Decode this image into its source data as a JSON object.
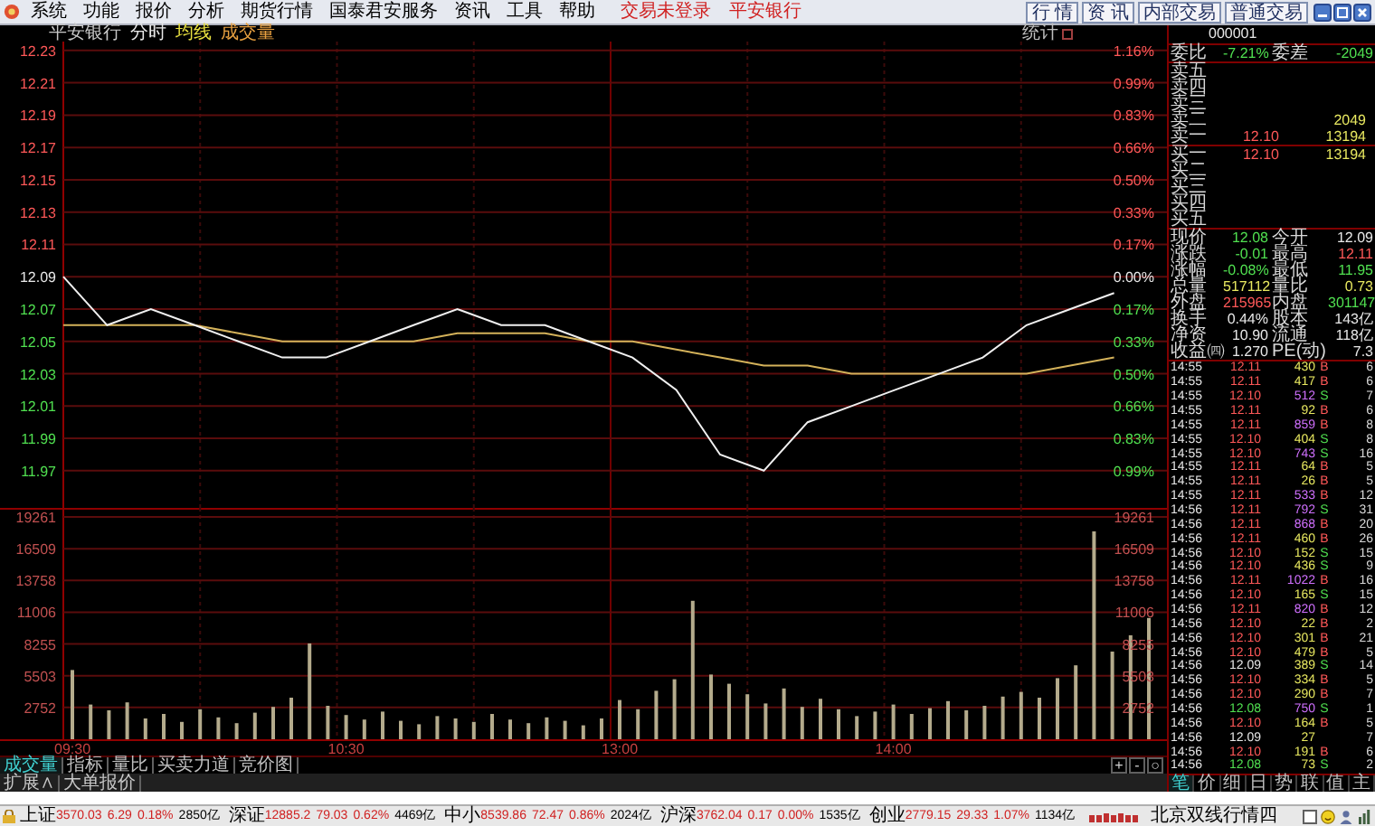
{
  "menu": [
    "系统",
    "功能",
    "报价",
    "分析",
    "期货行情",
    "国泰君安服务",
    "资讯",
    "工具",
    "帮助"
  ],
  "trade_status": [
    "交易未登录",
    "平安银行"
  ],
  "toolbar_buttons": [
    "行 情",
    "资 讯",
    "内部交易",
    "普通交易"
  ],
  "chart_header": {
    "stock": "平安银行",
    "items": [
      {
        "label": "分时",
        "color": "#e8e8e8"
      },
      {
        "label": "均线",
        "color": "#e8e040"
      },
      {
        "label": "成交量",
        "color": "#e8a040"
      }
    ],
    "stats_toggle": "统计"
  },
  "price_chart": {
    "chart_data": {
      "type": "line",
      "categories": [
        null,
        null,
        null,
        null,
        null,
        null,
        null,
        null,
        null,
        null,
        null,
        null,
        null,
        null,
        null,
        null,
        null,
        null,
        null,
        null,
        null,
        null,
        null,
        null,
        null
      ],
      "ylim": [
        11.947,
        12.2355
      ],
      "grid": true,
      "series": [
        {
          "color": "#f0f0f0",
          "values": [
            12.09,
            12.06,
            12.07,
            12.06,
            12.05,
            12.04,
            12.04,
            12.05,
            12.06,
            12.07,
            12.06,
            12.06,
            12.05,
            12.04,
            12.02,
            11.98,
            11.97,
            12.0,
            12.01,
            12.02,
            12.03,
            12.04,
            12.06,
            12.07,
            12.08
          ]
        },
        {
          "color": "#d4b25a",
          "values": [
            12.06,
            12.06,
            12.06,
            12.06,
            12.055,
            12.05,
            12.05,
            12.05,
            12.05,
            12.055,
            12.055,
            12.055,
            12.05,
            12.05,
            12.045,
            12.04,
            12.035,
            12.035,
            12.03,
            12.03,
            12.03,
            12.03,
            12.03,
            12.035,
            12.04
          ]
        }
      ],
      "yticks": [
        {
          "value": 12.23,
          "label": "12.23"
        },
        {
          "value": 12.21,
          "label": "12.21"
        },
        {
          "value": 12.19,
          "label": "12.19"
        },
        {
          "value": 12.17,
          "label": "12.17"
        },
        {
          "value": 12.15,
          "label": "12.15"
        },
        {
          "value": 12.13,
          "label": "12.13"
        },
        {
          "value": 12.11,
          "label": "12.11"
        },
        {
          "value": 12.09,
          "label": "12.09"
        },
        {
          "value": 12.07,
          "label": "12.07"
        },
        {
          "value": 12.05,
          "label": "12.05"
        },
        {
          "value": 12.03,
          "label": "12.03"
        },
        {
          "value": 12.01,
          "label": "12.01"
        },
        {
          "value": 11.99,
          "label": "11.99"
        },
        {
          "value": 11.97,
          "label": "11.97"
        }
      ]
    },
    "percent_labels": [
      {
        "text": "1.16%",
        "color": "#ff5858"
      },
      {
        "text": "0.99%",
        "color": "#ff5858"
      },
      {
        "text": "0.83%",
        "color": "#ff5858"
      },
      {
        "text": "0.66%",
        "color": "#ff5858"
      },
      {
        "text": "0.50%",
        "color": "#ff5858"
      },
      {
        "text": "0.33%",
        "color": "#ff5858"
      },
      {
        "text": "0.17%",
        "color": "#ff5858"
      },
      {
        "text": "0.00%",
        "color": "#e8e8e8"
      },
      {
        "text": "0.17%",
        "color": "#50e050"
      },
      {
        "text": "0.33%",
        "color": "#50e050"
      },
      {
        "text": "0.50%",
        "color": "#50e050"
      },
      {
        "text": "0.66%",
        "color": "#50e050"
      },
      {
        "text": "0.83%",
        "color": "#50e050"
      },
      {
        "text": "0.99%",
        "color": "#50e050"
      }
    ]
  },
  "volume_chart": {
    "chart_data": {
      "type": "bar",
      "categories": [
        "09:30",
        null,
        null,
        null,
        null,
        null,
        null,
        null,
        null,
        null,
        null,
        null,
        null,
        null,
        null,
        "10:30",
        null,
        null,
        null,
        null,
        null,
        null,
        null,
        null,
        null,
        null,
        null,
        null,
        null,
        null,
        "13:00",
        null,
        null,
        null,
        null,
        null,
        null,
        null,
        null,
        null,
        null,
        null,
        null,
        null,
        null,
        "14:00",
        null,
        null,
        null,
        null,
        null,
        null,
        null,
        null,
        null,
        null,
        null,
        null,
        null,
        null
      ],
      "ylim": [
        0,
        20043
      ],
      "grid": true,
      "series": [
        {
          "color": "#b4ab8c",
          "values": [
            6000,
            3000,
            2500,
            3200,
            1800,
            2200,
            1500,
            2600,
            1900,
            1400,
            2300,
            2800,
            3600,
            8300,
            2900,
            2100,
            1700,
            2400,
            1600,
            1300,
            2000,
            1800,
            1500,
            2200,
            1700,
            1400,
            1900,
            1600,
            1200,
            1800,
            3400,
            2600,
            4200,
            5200,
            12000,
            5600,
            4800,
            3900,
            3100,
            4400,
            2800,
            3500,
            2600,
            2000,
            2400,
            3000,
            2200,
            2700,
            3300,
            2500,
            2900,
            3700,
            4100,
            3600,
            5300,
            6400,
            18000,
            7600,
            9000,
            10500
          ]
        }
      ],
      "yticks": [
        {
          "value": 19261,
          "label": "19261"
        },
        {
          "value": 16509,
          "label": "16509"
        },
        {
          "value": 13758,
          "label": "13758"
        },
        {
          "value": 11006,
          "label": "11006"
        },
        {
          "value": 8255,
          "label": "8255"
        },
        {
          "value": 5503,
          "label": "5503"
        },
        {
          "value": 2752,
          "label": "2752"
        }
      ]
    },
    "right_labels": [
      "19261",
      "16509",
      "13758",
      "11006",
      "8255",
      "5503",
      "2752"
    ]
  },
  "chart_tabs": [
    {
      "label": "成交量",
      "selected": true
    },
    {
      "label": "指标",
      "selected": false
    },
    {
      "label": "量比",
      "selected": false
    },
    {
      "label": "买卖力道",
      "selected": false
    },
    {
      "label": "竞价图",
      "selected": false
    }
  ],
  "zoom_buttons": [
    "+",
    "-",
    "○"
  ],
  "bottom_tabs": [
    "扩展∧",
    "大单报价"
  ],
  "quote_panel": {
    "code": "000001",
    "ratio": [
      {
        "label": "委比",
        "value": "-7.21%"
      },
      {
        "label": "委差",
        "value": "-2049"
      }
    ],
    "book": [
      {
        "label": "卖五"
      },
      {
        "label": "卖四"
      },
      {
        "label": "卖三"
      },
      {
        "label": "卖二",
        "volume": "2049"
      },
      {
        "label": "卖一",
        "price": "12.10",
        "volume": "13194",
        "color": "#ff5858"
      },
      {
        "label": "买一",
        "price": "12.10",
        "volume": "13194",
        "color": "#ff5858"
      },
      {
        "label": "买二"
      },
      {
        "label": "买三"
      },
      {
        "label": "买四"
      },
      {
        "label": "买五"
      }
    ],
    "stats": [
      {
        "label": "现价",
        "value": "12.08",
        "color": "#50e050"
      },
      {
        "label": "今开",
        "value": "12.09",
        "color": "#e8e8e8"
      },
      {
        "label": "涨跌",
        "value": "-0.01",
        "color": "#50e050"
      },
      {
        "label": "最高",
        "value": "12.11",
        "color": "#ff5858"
      },
      {
        "label": "涨幅",
        "value": "-0.08%",
        "color": "#50e050"
      },
      {
        "label": "最低",
        "value": "11.95",
        "color": "#50e050"
      },
      {
        "label": "总量",
        "value": "517112",
        "color": "#e8e860"
      },
      {
        "label": "量比",
        "value": "0.73",
        "color": "#e8e860"
      },
      {
        "label": "外盘",
        "value": "215965",
        "color": "#ff5858"
      },
      {
        "label": "内盘",
        "value": "301147",
        "color": "#50e050"
      },
      {
        "label": "换手",
        "value": "0.44%",
        "color": "#e8e8e8"
      },
      {
        "label": "股本",
        "value": "143亿",
        "color": "#e8e8e8"
      },
      {
        "label": "净资",
        "value": "10.90",
        "color": "#e8e8e8"
      },
      {
        "label": "流通",
        "value": "118亿",
        "color": "#e8e8e8"
      },
      {
        "label": "收益㈣",
        "value": "1.270",
        "color": "#e8e8e8"
      },
      {
        "label": "PE(动)",
        "value": "7.3",
        "color": "#e8e8e8"
      }
    ],
    "ticks": [
      {
        "time": "14:55",
        "price": "12.11",
        "color": "#ff5858",
        "volume": "430",
        "large": false,
        "side": "B",
        "buy": true,
        "count": "6"
      },
      {
        "time": "14:55",
        "price": "12.11",
        "color": "#ff5858",
        "volume": "417",
        "large": false,
        "side": "B",
        "buy": true,
        "count": "6"
      },
      {
        "time": "14:55",
        "price": "12.10",
        "color": "#ff5858",
        "volume": "512",
        "large": true,
        "side": "S",
        "buy": false,
        "count": "7"
      },
      {
        "time": "14:55",
        "price": "12.11",
        "color": "#ff5858",
        "volume": "92",
        "large": false,
        "side": "B",
        "buy": true,
        "count": "6"
      },
      {
        "time": "14:55",
        "price": "12.11",
        "color": "#ff5858",
        "volume": "859",
        "large": true,
        "side": "B",
        "buy": true,
        "count": "8"
      },
      {
        "time": "14:55",
        "price": "12.10",
        "color": "#ff5858",
        "volume": "404",
        "large": false,
        "side": "S",
        "buy": false,
        "count": "8"
      },
      {
        "time": "14:55",
        "price": "12.10",
        "color": "#ff5858",
        "volume": "743",
        "large": true,
        "side": "S",
        "buy": false,
        "count": "16"
      },
      {
        "time": "14:55",
        "price": "12.11",
        "color": "#ff5858",
        "volume": "64",
        "large": false,
        "side": "B",
        "buy": true,
        "count": "5"
      },
      {
        "time": "14:55",
        "price": "12.11",
        "color": "#ff5858",
        "volume": "26",
        "large": false,
        "side": "B",
        "buy": true,
        "count": "5"
      },
      {
        "time": "14:55",
        "price": "12.11",
        "color": "#ff5858",
        "volume": "533",
        "large": true,
        "side": "B",
        "buy": true,
        "count": "12"
      },
      {
        "time": "14:56",
        "price": "12.11",
        "color": "#ff5858",
        "volume": "792",
        "large": true,
        "side": "S",
        "buy": false,
        "count": "31"
      },
      {
        "time": "14:56",
        "price": "12.11",
        "color": "#ff5858",
        "volume": "868",
        "large": true,
        "side": "B",
        "buy": true,
        "count": "20"
      },
      {
        "time": "14:56",
        "price": "12.11",
        "color": "#ff5858",
        "volume": "460",
        "large": false,
        "side": "B",
        "buy": true,
        "count": "26"
      },
      {
        "time": "14:56",
        "price": "12.10",
        "color": "#ff5858",
        "volume": "152",
        "large": false,
        "side": "S",
        "buy": false,
        "count": "15"
      },
      {
        "time": "14:56",
        "price": "12.10",
        "color": "#ff5858",
        "volume": "436",
        "large": false,
        "side": "S",
        "buy": false,
        "count": "9"
      },
      {
        "time": "14:56",
        "price": "12.11",
        "color": "#ff5858",
        "volume": "1022",
        "large": true,
        "side": "B",
        "buy": true,
        "count": "16"
      },
      {
        "time": "14:56",
        "price": "12.10",
        "color": "#ff5858",
        "volume": "165",
        "large": false,
        "side": "S",
        "buy": false,
        "count": "15"
      },
      {
        "time": "14:56",
        "price": "12.11",
        "color": "#ff5858",
        "volume": "820",
        "large": true,
        "side": "B",
        "buy": true,
        "count": "12"
      },
      {
        "time": "14:56",
        "price": "12.10",
        "color": "#ff5858",
        "volume": "22",
        "large": false,
        "side": "B",
        "buy": true,
        "count": "2"
      },
      {
        "time": "14:56",
        "price": "12.10",
        "color": "#ff5858",
        "volume": "301",
        "large": false,
        "side": "B",
        "buy": true,
        "count": "21"
      },
      {
        "time": "14:56",
        "price": "12.10",
        "color": "#ff5858",
        "volume": "479",
        "large": false,
        "side": "B",
        "buy": true,
        "count": "5"
      },
      {
        "time": "14:56",
        "price": "12.09",
        "color": "#e8e8e8",
        "volume": "389",
        "large": false,
        "side": "S",
        "buy": false,
        "count": "14"
      },
      {
        "time": "14:56",
        "price": "12.10",
        "color": "#ff5858",
        "volume": "334",
        "large": false,
        "side": "B",
        "buy": true,
        "count": "5"
      },
      {
        "time": "14:56",
        "price": "12.10",
        "color": "#ff5858",
        "volume": "290",
        "large": false,
        "side": "B",
        "buy": true,
        "count": "7"
      },
      {
        "time": "14:56",
        "price": "12.08",
        "color": "#50e050",
        "volume": "750",
        "large": true,
        "side": "S",
        "buy": false,
        "count": "1"
      },
      {
        "time": "14:56",
        "price": "12.10",
        "color": "#ff5858",
        "volume": "164",
        "large": false,
        "side": "B",
        "buy": true,
        "count": "5"
      },
      {
        "time": "14:56",
        "price": "12.09",
        "color": "#e8e8e8",
        "volume": "27",
        "large": false,
        "count": "7"
      },
      {
        "time": "14:56",
        "price": "12.10",
        "color": "#ff5858",
        "volume": "191",
        "large": false,
        "side": "B",
        "buy": true,
        "count": "6"
      },
      {
        "time": "14:56",
        "price": "12.08",
        "color": "#50e050",
        "volume": "73",
        "large": false,
        "side": "S",
        "buy": false,
        "count": "2"
      }
    ],
    "detail_tabs": [
      {
        "label": "笔",
        "selected": true
      },
      {
        "label": "价",
        "selected": false
      },
      {
        "label": "细",
        "selected": false
      },
      {
        "label": "日",
        "selected": false
      },
      {
        "label": "势",
        "selected": false
      },
      {
        "label": "联",
        "selected": false
      },
      {
        "label": "值",
        "selected": false
      },
      {
        "label": "主",
        "selected": false
      }
    ]
  },
  "status_bar": {
    "indices": [
      {
        "name": "上证",
        "value": "3570.03",
        "change": "6.29",
        "pct": "0.18%",
        "amount": "2850亿"
      },
      {
        "name": "深证",
        "value": "12885.2",
        "change": "79.03",
        "pct": "0.62%",
        "amount": "4469亿"
      },
      {
        "name": "中小",
        "value": "8539.86",
        "change": "72.47",
        "pct": "0.86%",
        "amount": "2024亿"
      },
      {
        "name": "沪深",
        "value": "3762.04",
        "change": "0.17",
        "pct": "0.00%",
        "amount": "1535亿"
      },
      {
        "name": "创业",
        "value": "2779.15",
        "change": "29.33",
        "pct": "1.07%",
        "amount": "1134亿"
      }
    ],
    "server": "北京双线行情四"
  }
}
